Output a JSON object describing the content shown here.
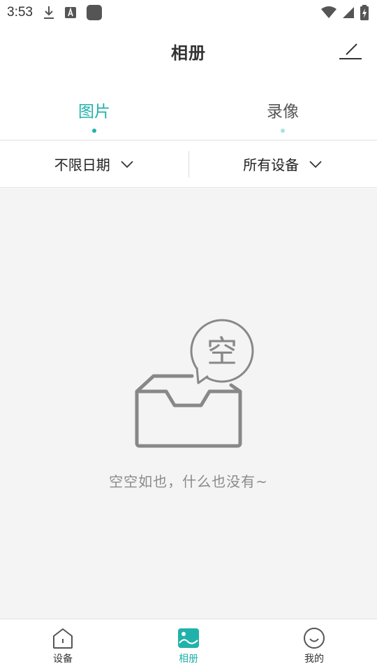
{
  "status_bar": {
    "time": "3:53",
    "icons": [
      "download-icon",
      "a-notification-icon",
      "app-notification-icon",
      "wifi-icon",
      "signal-icon",
      "battery-icon"
    ]
  },
  "header": {
    "title": "相册",
    "edit_icon": "edit-icon"
  },
  "tabs": [
    {
      "label": "图片",
      "active": true
    },
    {
      "label": "录像",
      "active": false
    }
  ],
  "filters": {
    "date": "不限日期",
    "device": "所有设备"
  },
  "empty_state": {
    "bubble_text": "空",
    "message": "空空如也，什么也没有~"
  },
  "bottom_nav": [
    {
      "label": "设备",
      "icon": "home-icon",
      "active": false
    },
    {
      "label": "相册",
      "icon": "photo-icon",
      "active": true
    },
    {
      "label": "我的",
      "icon": "smile-icon",
      "active": false
    }
  ],
  "colors": {
    "accent": "#20b2aa",
    "accent_light": "#a8e3e0",
    "text": "#333333",
    "muted": "#8a8a8a",
    "background": "#f4f4f4"
  }
}
